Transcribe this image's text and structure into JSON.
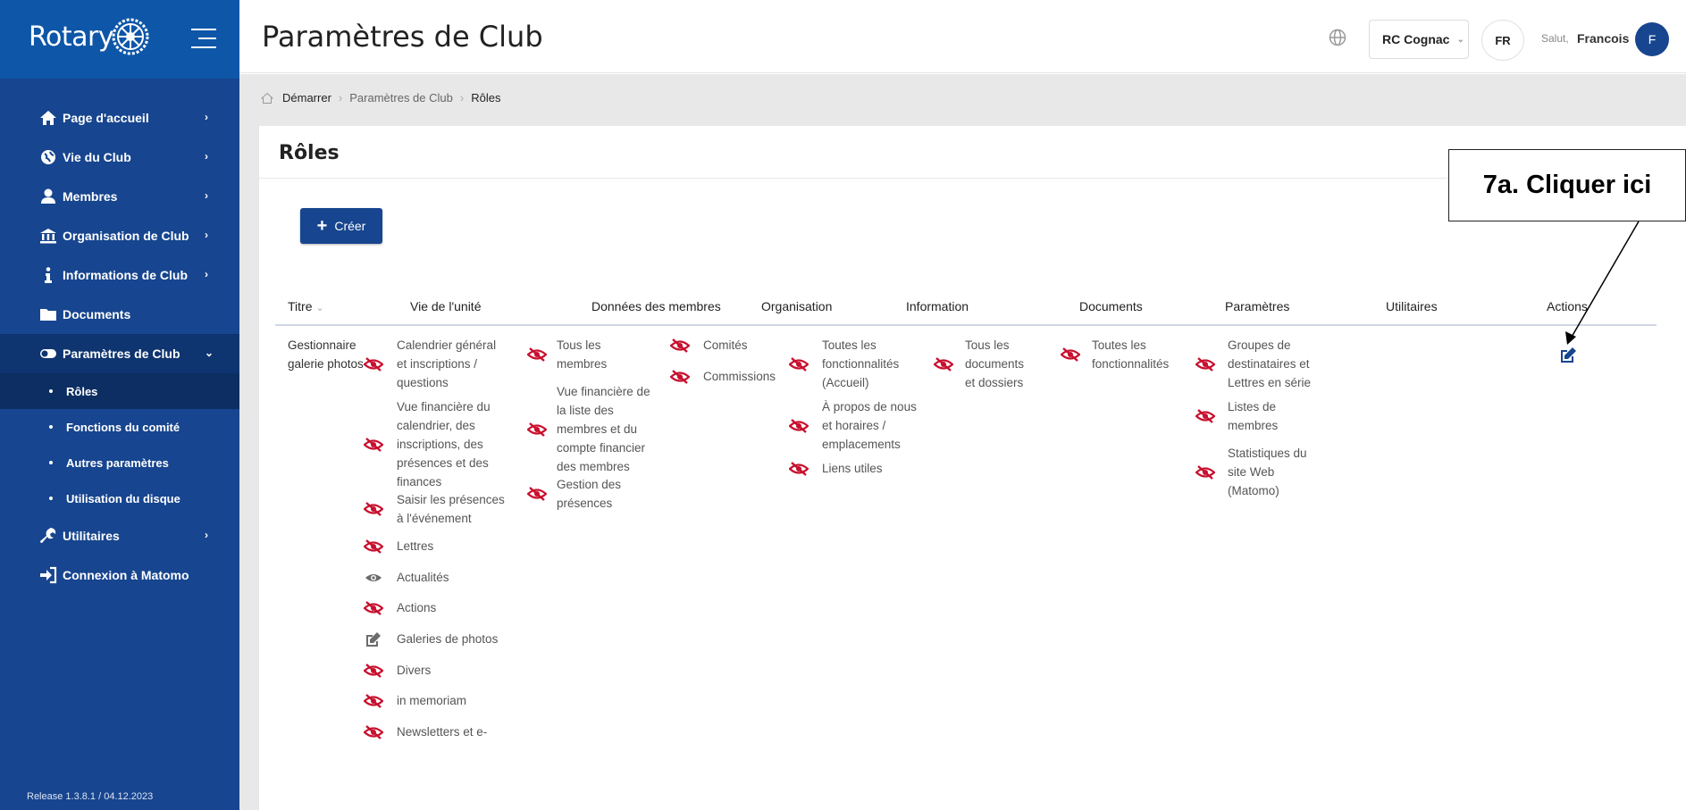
{
  "sidebar": {
    "logo_text": "Rotary",
    "nav": [
      {
        "label": "Page d'accueil",
        "icon": "home-icon"
      },
      {
        "label": "Vie du Club",
        "icon": "globe-icon"
      },
      {
        "label": "Membres",
        "icon": "user-icon"
      },
      {
        "label": "Organisation de Club",
        "icon": "building-icon"
      },
      {
        "label": "Informations de Club",
        "icon": "info-icon"
      },
      {
        "label": "Documents",
        "icon": "folder-icon"
      },
      {
        "label": "Paramètres de Club",
        "icon": "toggle-icon"
      }
    ],
    "sub": [
      {
        "label": "Rôles"
      },
      {
        "label": "Fonctions du comité"
      },
      {
        "label": "Autres paramètres"
      },
      {
        "label": "Utilisation du disque"
      }
    ],
    "nav_bottom": [
      {
        "label": "Utilitaires",
        "icon": "wrench-icon"
      },
      {
        "label": "Connexion à Matomo",
        "icon": "sign-in-icon"
      }
    ],
    "release": "Release 1.3.8.1 / 04.12.2023"
  },
  "header": {
    "title": "Paramètres de Club",
    "club": "RC Cognac",
    "lang": "FR",
    "greeting": "Salut,",
    "user": "Francois",
    "avatar_initial": "F"
  },
  "breadcrumb": [
    "Démarrer",
    "Paramètres de Club",
    "Rôles"
  ],
  "card": {
    "title": "Rôles",
    "create_label": "Créer"
  },
  "table": {
    "headers": [
      "Titre",
      "Vie de l'unité",
      "Données des membres",
      "Organisation",
      "Information",
      "Documents",
      "Paramètres",
      "Utilitaires",
      "Actions"
    ],
    "row_title": [
      "Gestionnaire",
      "galerie photos"
    ],
    "vie": [
      {
        "lines": [
          "Calendrier général",
          "et inscriptions /",
          "questions"
        ],
        "icon": "eye-slash-icon"
      },
      {
        "lines": [
          "Vue financière du",
          "calendrier, des",
          "inscriptions, des",
          "présences et des",
          "finances"
        ],
        "icon": "eye-slash-icon"
      },
      {
        "lines": [
          "Saisir les présences",
          "à l'événement"
        ],
        "icon": "eye-slash-icon"
      },
      {
        "lines": [
          "Lettres"
        ],
        "icon": "eye-slash-icon"
      },
      {
        "lines": [
          "Actualités"
        ],
        "icon": "eye-icon"
      },
      {
        "lines": [
          "Actions"
        ],
        "icon": "eye-slash-icon"
      },
      {
        "lines": [
          "Galeries de photos"
        ],
        "icon": "edit-icon"
      },
      {
        "lines": [
          "Divers"
        ],
        "icon": "eye-slash-icon"
      },
      {
        "lines": [
          "in memoriam"
        ],
        "icon": "eye-slash-icon"
      },
      {
        "lines": [
          "Newsletters et e-"
        ],
        "icon": "eye-slash-icon"
      }
    ],
    "membres": [
      {
        "lines": [
          "Tous les",
          "membres"
        ],
        "icon": "eye-slash-icon"
      },
      {
        "lines": [
          "Vue financière de",
          "la liste des",
          "membres et du",
          "compte financier",
          "des membres"
        ],
        "icon": "eye-slash-icon"
      },
      {
        "lines": [
          "Gestion des",
          "présences"
        ],
        "icon": "eye-slash-icon"
      }
    ],
    "organisation": [
      {
        "lines": [
          "Comités"
        ],
        "icon": "eye-slash-icon"
      },
      {
        "lines": [
          "Commissions"
        ],
        "icon": "eye-slash-icon"
      }
    ],
    "information": [
      {
        "lines": [
          "Toutes les",
          "fonctionnalités",
          "(Accueil)"
        ],
        "icon": "eye-slash-icon"
      },
      {
        "lines": [
          "À propos de nous",
          "et horaires /",
          "emplacements"
        ],
        "icon": "eye-slash-icon"
      },
      {
        "lines": [
          "Liens utiles"
        ],
        "icon": "eye-slash-icon"
      }
    ],
    "documents": [
      {
        "lines": [
          "Tous les",
          "documents",
          "et dossiers"
        ],
        "icon": "eye-slash-icon"
      }
    ],
    "parametres": [
      {
        "lines": [
          "Toutes les",
          "fonctionnalités"
        ],
        "icon": "eye-slash-icon"
      }
    ],
    "utilitaires": [
      {
        "lines": [
          "Groupes de",
          "destinataires et",
          "Lettres en série"
        ],
        "icon": "eye-slash-icon"
      },
      {
        "lines": [
          "Listes de",
          "membres"
        ],
        "icon": "eye-slash-icon"
      },
      {
        "lines": [
          "Statistiques du",
          "site Web",
          "(Matomo)"
        ],
        "icon": "eye-slash-icon"
      }
    ]
  },
  "annotation": {
    "callout": "7a. Cliquer  ici"
  },
  "colors": {
    "sidebar": "#17458f",
    "logo_bar": "#0e56a8",
    "primary": "#17458f",
    "hidden_icon": "#c8102e"
  }
}
